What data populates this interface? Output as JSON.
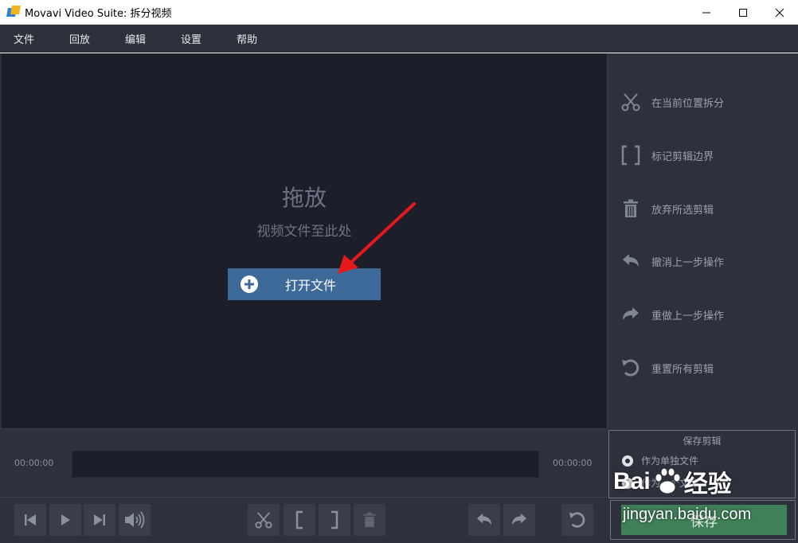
{
  "window": {
    "title": "Movavi Video Suite: 拆分视频",
    "controls": [
      "minimize-icon",
      "maximize-icon",
      "close-icon"
    ]
  },
  "menu": {
    "items": [
      {
        "label": "文件"
      },
      {
        "label": "回放"
      },
      {
        "label": "编辑"
      },
      {
        "label": "设置"
      },
      {
        "label": "帮助"
      }
    ]
  },
  "drop": {
    "title": "拖放",
    "subtitle": "视频文件至此处",
    "open_button": "打开文件"
  },
  "actions": {
    "items": [
      {
        "label": "在当前位置拆分",
        "icon": "scissors-icon"
      },
      {
        "label": "标记剪辑边界",
        "icon": "brackets-icon"
      },
      {
        "label": "放弃所选剪辑",
        "icon": "trash-icon"
      },
      {
        "label": "撤消上一步操作",
        "icon": "undo-icon"
      },
      {
        "label": "重做上一步操作",
        "icon": "redo-icon"
      },
      {
        "label": "重置所有剪辑",
        "icon": "reset-icon"
      }
    ]
  },
  "timeline": {
    "start_time": "00:00:00",
    "end_time": "00:00:00"
  },
  "save": {
    "group_title": "保存剪辑",
    "options": [
      "作为单独文件",
      "作为一个文件"
    ],
    "selected": 0,
    "button": "保存"
  },
  "controls": {
    "icons": [
      "skip-back-icon",
      "play-icon",
      "skip-forward-icon",
      "volume-icon",
      "scissors-icon",
      "bracket-left-icon",
      "bracket-right-icon",
      "trash-icon",
      "undo-icon",
      "redo-icon",
      "reset-icon"
    ]
  },
  "watermark": {
    "logo_text_1": "Bai",
    "logo_text_2": "经验",
    "url": "jingyan.baidu.com"
  },
  "colors": {
    "menubar_bg": "#2d313c",
    "drop_bg": "#1c1f29",
    "open_button": "#3e6a9a",
    "save_button": "#3f7f59",
    "annotation_arrow": "#e5181c"
  }
}
